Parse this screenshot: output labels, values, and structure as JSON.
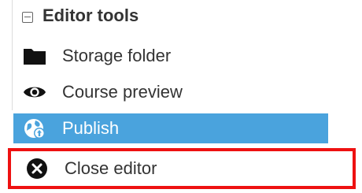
{
  "panel": {
    "title": "Editor tools",
    "items": [
      {
        "label": "Storage folder",
        "icon": "folder-icon"
      },
      {
        "label": "Course preview",
        "icon": "eye-icon"
      },
      {
        "label": "Publish",
        "icon": "globe-upload-icon",
        "active": true
      },
      {
        "label": "Close editor",
        "icon": "close-circle-icon",
        "highlighted": true
      }
    ]
  },
  "colors": {
    "active_bg": "#4aa3dd",
    "highlight_border": "#ee1111",
    "text": "#333333"
  }
}
